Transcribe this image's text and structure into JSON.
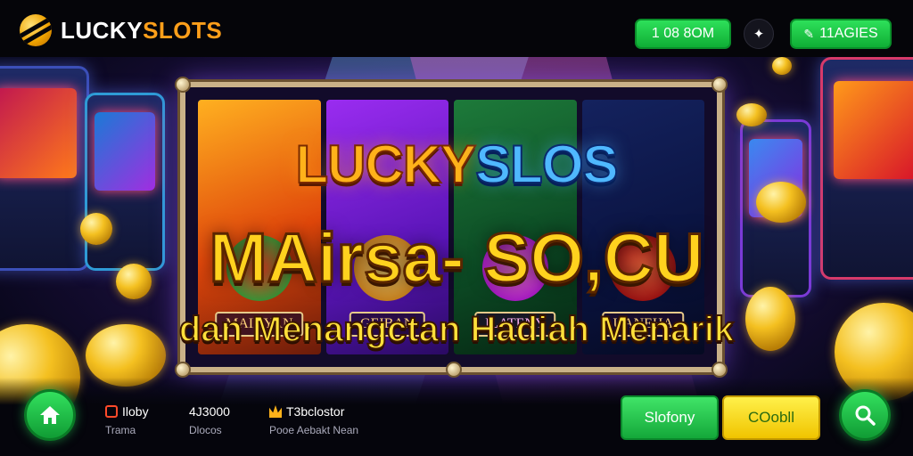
{
  "header": {
    "logo_text_main": "LUCKY",
    "logo_text_accent": "SLOTS",
    "balance_label": "1 08 8OM",
    "bonus_label": "11AGIES"
  },
  "banner": {
    "title_part1": "LUCKY",
    "title_part2": "SLOS",
    "headline": "MAirsa- SO,CU",
    "tagline": "dan Menangctan Hadiah Menarik",
    "reels": [
      {
        "label": "MAINYAN"
      },
      {
        "label": "GEIBAN"
      },
      {
        "label": "ILATENY"
      },
      {
        "label": "UANEHA"
      }
    ]
  },
  "footer": {
    "stats": [
      {
        "value": "Iloby",
        "sub": "Trama"
      },
      {
        "value": "4J3000",
        "sub": "Dlocos"
      },
      {
        "value": "T3bclostor",
        "sub": "Pooe Aebakt Nean"
      }
    ],
    "green_button": "Slofony",
    "yellow_button": "COobll"
  },
  "colors": {
    "accent_green": "#14a83a",
    "accent_yellow": "#f0c400",
    "logo_orange": "#ff9f1a"
  }
}
